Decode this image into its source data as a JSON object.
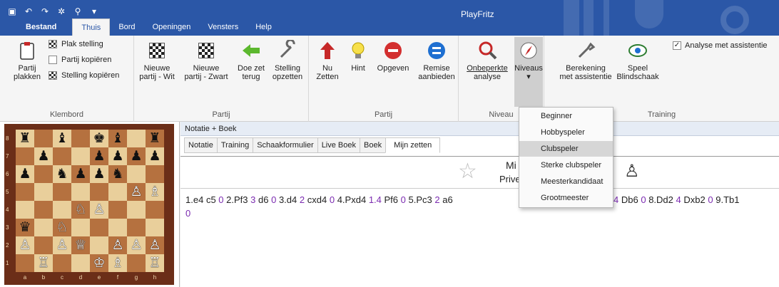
{
  "app": {
    "title": "PlayFritz",
    "qat_icons": [
      "save-icon",
      "undo-icon",
      "redo-icon",
      "gear-icon",
      "search-icon",
      "customize-dropdown-icon"
    ],
    "qat_glyphs": [
      "▣",
      "↶",
      "↷",
      "✲",
      "⚲",
      "▾"
    ]
  },
  "menu": {
    "tabs": [
      "Bestand",
      "Thuis",
      "Bord",
      "Openingen",
      "Vensters",
      "Help"
    ],
    "active": "Thuis"
  },
  "ribbon": {
    "klembord": {
      "label": "Klembord",
      "paste_label_1": "Partij",
      "paste_label_2": "plakken",
      "plak_stelling": "Plak stelling",
      "partij_kopieren": "Partij kopiëren",
      "stelling_kopieren": "Stelling kopiëren"
    },
    "partij1": {
      "label": "Partij",
      "nieuwe_wit_1": "Nieuwe",
      "nieuwe_wit_2": "partij - Wit",
      "nieuwe_zwart_1": "Nieuwe",
      "nieuwe_zwart_2": "partij - Zwart",
      "doe_zet_1": "Doe zet",
      "doe_zet_2": "terug",
      "stelling_1": "Stelling",
      "stelling_2": "opzetten"
    },
    "partij2": {
      "label": "Partij",
      "nu_1": "Nu",
      "nu_2": "Zetten",
      "hint": "Hint",
      "opgeven": "Opgeven",
      "remise_1": "Remise",
      "remise_2": "aanbieden"
    },
    "niveau": {
      "label": "Niveau",
      "onbeperkte_1": "Onbeperkte",
      "onbeperkte_2": "analyse",
      "niveaus": "Niveaus",
      "arrow": "▾"
    },
    "training": {
      "label": "Training",
      "berekening_1": "Berekening",
      "berekening_2": "met assistentie",
      "speel_1": "Speel",
      "speel_2": "Blindschaak",
      "analyse_check": "Analyse met assistentie",
      "check_mark": "✓"
    }
  },
  "levels_dropdown": {
    "items": [
      "Beginner",
      "Hobbyspeler",
      "Clubspeler",
      "Sterke clubspeler",
      "Meesterkandidaat",
      "Grootmeester"
    ],
    "selected": "Clubspeler"
  },
  "board": {
    "rank_labels": [
      "8",
      "7",
      "6",
      "5",
      "4",
      "3",
      "2",
      "1"
    ],
    "file_labels": [
      "a",
      "b",
      "c",
      "d",
      "e",
      "f",
      "g",
      "h"
    ],
    "position": [
      [
        "♜",
        "",
        "♝",
        "",
        "♚",
        "♝",
        "",
        "♜"
      ],
      [
        "",
        "♟",
        "",
        "",
        "♟",
        "♟",
        "♟",
        "♟"
      ],
      [
        "♟",
        "",
        "♞",
        "♟",
        "♟",
        "♞",
        "",
        ""
      ],
      [
        "",
        "",
        "",
        "",
        "",
        "",
        "♙",
        "♗"
      ],
      [
        "",
        "",
        "",
        "♘",
        "♙",
        "",
        "",
        ""
      ],
      [
        "♛",
        "",
        "♘",
        "",
        "",
        "",
        "",
        ""
      ],
      [
        "♙",
        "",
        "♙",
        "♕",
        "",
        "♙",
        "♙",
        "♙"
      ],
      [
        "",
        "♖",
        "",
        "",
        "♔",
        "♗",
        "",
        "♖"
      ]
    ]
  },
  "notation": {
    "panel_title": "Notatie + Boek",
    "tabs": [
      "Notatie",
      "Training",
      "Schaakformulier",
      "Live Boek",
      "Boek",
      "Mijn zetten"
    ],
    "active_tab": "Mijn zetten",
    "header_line1": "Mi",
    "header_line2": "Prive -",
    "header_star": "☆",
    "header_pawn": "♙",
    "moves": [
      {
        "m": "1.e4",
        "e": ""
      },
      {
        "m": "c5",
        "e": "0"
      },
      {
        "m": "2.Pf3",
        "e": "3"
      },
      {
        "m": "d6",
        "e": "0"
      },
      {
        "m": "3.d4",
        "e": "2"
      },
      {
        "m": "cxd4",
        "e": "0"
      },
      {
        "m": "4.Pxd4",
        "e": "1.4"
      },
      {
        "m": "Pf6",
        "e": "0"
      },
      {
        "m": "5.Pc3",
        "e": "2"
      },
      {
        "m": "a6",
        "e": ""
      }
    ],
    "moves_tail": [
      {
        "m": "",
        "e": "4"
      },
      {
        "m": "Db6",
        "e": "0"
      },
      {
        "m": "8.Dd2",
        "e": "4"
      },
      {
        "m": "Dxb2",
        "e": "0"
      },
      {
        "m": "9.Tb1",
        "e": ""
      }
    ],
    "last_line": "0"
  }
}
